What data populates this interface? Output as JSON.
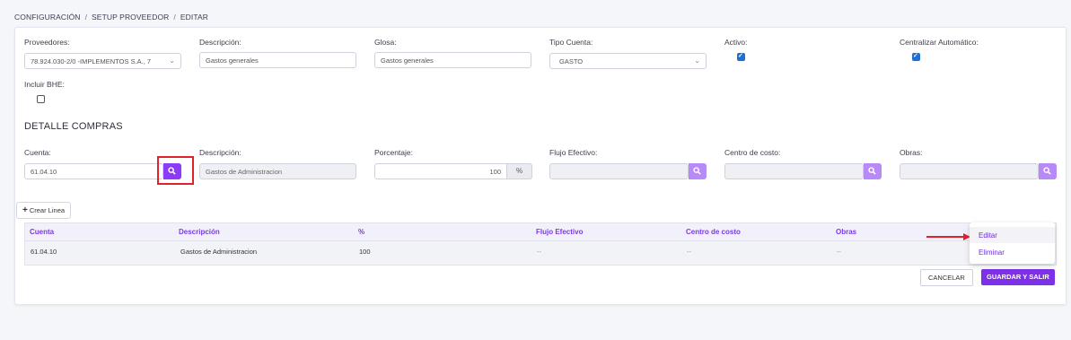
{
  "breadcrumb": [
    "CONFIGURACIÓN",
    "SETUP PROVEEDOR",
    "EDITAR"
  ],
  "form": {
    "proveedores": {
      "label": "Proveedores:",
      "value": "78.924.030-2/0 -IMPLEMENTOS S.A., 7"
    },
    "descripcion": {
      "label": "Descripción:",
      "value": "Gastos generales"
    },
    "glosa": {
      "label": "Glosa:",
      "value": "Gastos generales"
    },
    "tipo_cuenta": {
      "label": "Tipo Cuenta:",
      "value": "GASTO"
    },
    "activo": {
      "label": "Activo:",
      "checked": true
    },
    "centralizar": {
      "label": "Centralizar Automático:",
      "checked": true
    },
    "incluir_bhe": {
      "label": "Incluir BHE:",
      "checked": false
    }
  },
  "detalle": {
    "title": "DETALLE COMPRAS",
    "cuenta": {
      "label": "Cuenta:",
      "value": "61.04.10"
    },
    "descripcion": {
      "label": "Descripción:",
      "value": "Gastos de Administracion"
    },
    "porcentaje": {
      "label": "Porcentaje:",
      "value": "100",
      "unit": "%"
    },
    "flujo": {
      "label": "Flujo Efectivo:",
      "value": ""
    },
    "centro": {
      "label": "Centro de costo:",
      "value": ""
    },
    "obras": {
      "label": "Obras:",
      "value": ""
    }
  },
  "add_line_label": "Crear Linea",
  "table": {
    "headers": [
      "Cuenta",
      "Descripción",
      "%",
      "Flujo Efectivo",
      "Centro de costo",
      "Obras"
    ],
    "rows": [
      [
        "61.04.10",
        "Gastos de Administracion",
        "100",
        "--",
        "--",
        "--"
      ]
    ]
  },
  "context_menu": [
    "Editar",
    "Eliminar"
  ],
  "buttons": {
    "cancel": "CANCELAR",
    "save": "GUARDAR Y SALIR"
  },
  "colors": {
    "accent": "#7e2fe8",
    "highlight": "#e0222b",
    "checkbox": "#1f6fd6"
  },
  "icons": {
    "search": "search-icon",
    "caret": "chevron-down-icon",
    "plus": "plus-icon",
    "arrow": "arrow-right-icon"
  }
}
